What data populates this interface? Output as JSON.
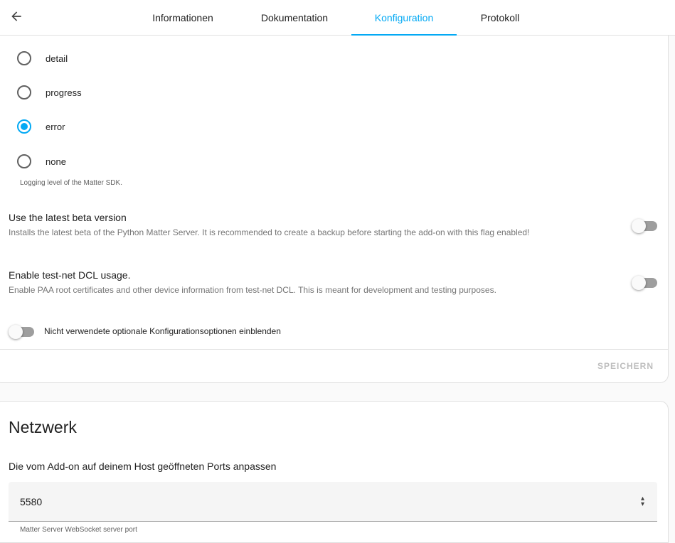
{
  "header": {
    "back_icon": "arrow-left-icon",
    "tabs": [
      {
        "label": "Informationen",
        "active": false
      },
      {
        "label": "Dokumentation",
        "active": false
      },
      {
        "label": "Konfiguration",
        "active": true
      },
      {
        "label": "Protokoll",
        "active": false
      }
    ],
    "accent_color": "#03a9f4"
  },
  "log_level": {
    "options": [
      {
        "label": "detail",
        "selected": false
      },
      {
        "label": "progress",
        "selected": false
      },
      {
        "label": "error",
        "selected": true
      },
      {
        "label": "none",
        "selected": false
      }
    ],
    "helper": "Logging level of the Matter SDK."
  },
  "beta": {
    "title": "Use the latest beta version",
    "description": "Installs the latest beta of the Python Matter Server. It is recommended to create a backup before starting the add-on with this flag enabled!",
    "enabled": false
  },
  "testnet": {
    "title": "Enable test-net DCL usage.",
    "description": "Enable PAA root certificates and other device information from test-net DCL. This is meant for development and testing purposes.",
    "enabled": false
  },
  "show_unused": {
    "label": "Nicht verwendete optionale Konfigurationsoptionen einblenden",
    "enabled": false
  },
  "save_label": "SPEICHERN",
  "network": {
    "title": "Netzwerk",
    "description": "Die vom Add-on auf deinem Host geöffneten Ports anpassen",
    "port_value": "5580",
    "port_helper": "Matter Server WebSocket server port"
  }
}
